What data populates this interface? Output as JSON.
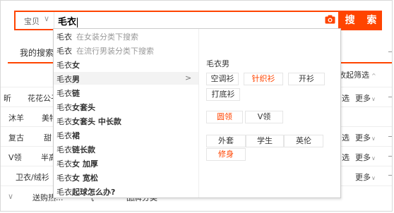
{
  "search": {
    "scope_label": "宝贝",
    "query": "毛衣",
    "button_label": "搜 索"
  },
  "background": {
    "tab_active": "我的搜索",
    "right_tab": "收起筛选",
    "more_label": "更多",
    "left_items": [
      "花花公子",
      "沐羊",
      "美特",
      "复古",
      "甜",
      "V领",
      "半高",
      "卫衣/绒衫",
      "送购热..."
    ],
    "partial_right": [
      "选",
      "选",
      "选"
    ],
    "partial_bottom": [
      "气",
      "品牌分类"
    ]
  },
  "suggestions": [
    {
      "keyword": "毛衣",
      "suffix": "在女装分类下搜索",
      "type": "scope"
    },
    {
      "keyword": "毛衣",
      "suffix": "在流行男装分类下搜索",
      "type": "scope"
    },
    {
      "prefix": "毛衣",
      "bold": "女",
      "arrow": false
    },
    {
      "prefix": "毛衣",
      "bold": "男",
      "arrow": true,
      "active": true
    },
    {
      "prefix": "毛衣",
      "bold": "链",
      "arrow": false
    },
    {
      "prefix": "毛衣",
      "bold": "女套头",
      "arrow": false
    },
    {
      "prefix": "毛衣",
      "bold": "女套头 中长款",
      "arrow": false
    },
    {
      "prefix": "毛衣",
      "bold": "裙",
      "arrow": false
    },
    {
      "prefix": "毛衣",
      "bold": "链长款",
      "arrow": false
    },
    {
      "prefix": "毛衣",
      "bold": "女 加厚",
      "arrow": false
    },
    {
      "prefix": "毛衣",
      "bold": "女 宽松",
      "arrow": false
    },
    {
      "prefix": "毛衣",
      "bold": "起球怎么办?",
      "arrow": false
    }
  ],
  "panel": {
    "title": "毛衣男",
    "group1": [
      {
        "label": "空调衫",
        "highlight": false
      },
      {
        "label": "针织衫",
        "highlight": true
      },
      {
        "label": "开衫",
        "highlight": false
      },
      {
        "label": "打底衫",
        "highlight": false
      }
    ],
    "group2": [
      {
        "label": "圆领",
        "highlight": true
      },
      {
        "label": "V领",
        "highlight": false
      }
    ],
    "group3": [
      {
        "label": "外套",
        "highlight": false
      },
      {
        "label": "学生",
        "highlight": false
      },
      {
        "label": "英伦",
        "highlight": false
      },
      {
        "label": "修身",
        "highlight": true
      }
    ]
  },
  "colors": {
    "accent": "#ff4400",
    "border": "#e5e5e5",
    "muted": "#999999"
  }
}
